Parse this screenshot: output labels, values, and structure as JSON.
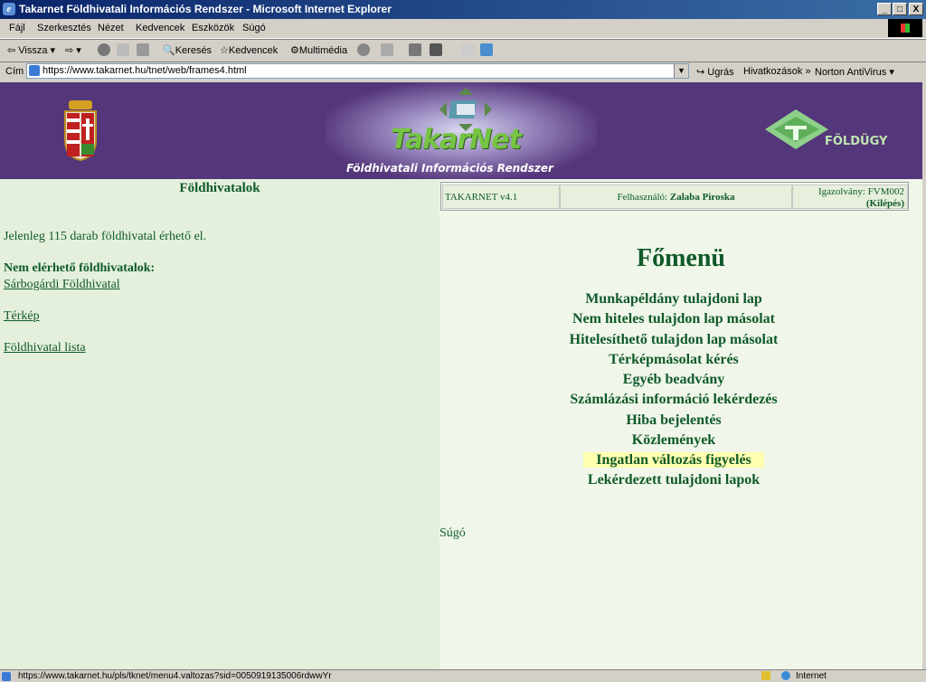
{
  "window": {
    "title": "Takarnet Földhivatali Információs Rendszer - Microsoft Internet Explorer",
    "min": "_",
    "max": "□",
    "close": "X"
  },
  "menubar": [
    "Fájl",
    "Szerkesztés",
    "Nézet",
    "Kedvencek",
    "Eszközök",
    "Súgó"
  ],
  "toolbar": {
    "back": "Vissza",
    "search": "Keresés",
    "favorites": "Kedvencek",
    "multimedia": "Multimédia"
  },
  "address": {
    "label": "Cím",
    "url": "https://www.takarnet.hu/tnet/web/frames4.html",
    "go": "Ugrás",
    "links": "Hivatkozások",
    "norton": "Norton AntiVirus"
  },
  "banner": {
    "brand": "TakarNet",
    "subtitle": "Földhivatali Információs Rendszer",
    "partner": "FÖLDÜGY"
  },
  "left": {
    "title": "Földhivatalok",
    "available": "Jelenleg 115 darab földhivatal érhető el.",
    "unavailable_heading": "Nem elérhető földhivatalok:",
    "unavailable_item": "Sárbogárdi Földhivatal",
    "map_link": "Térkép",
    "list_link": "Földhivatal lista"
  },
  "info": {
    "version": "TAKARNET v4.1",
    "user_label": "Felhasználó:",
    "user_name": "Zalaba Piroska",
    "id_label": "Igazolvány: FVM002",
    "logout": "(Kilépés)"
  },
  "main": {
    "title": "Főmenü",
    "items": [
      "Munkapéldány tulajdoni lap",
      "Nem hiteles tulajdon lap másolat",
      "Hitelesíthető tulajdon lap másolat",
      "Térképmásolat kérés",
      "Egyéb beadvány",
      "Számlázási információ lekérdezés",
      "Hiba bejelentés",
      "Közlemények",
      "Ingatlan változás figyelés",
      "Lekérdezett tulajdoni lapok"
    ],
    "help": "Súgó"
  },
  "status": {
    "url": "https://www.takarnet.hu/pls/tknet/menu4.valtozas?sid=005091913500​6rdwwYr",
    "zone": "Internet"
  }
}
